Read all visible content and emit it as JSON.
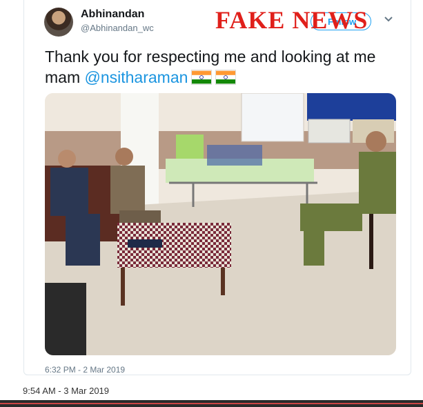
{
  "tweet": {
    "display_name": "Abhinandan",
    "handle": "@Abhinandan_wc",
    "follow_label": "Follow",
    "text_before": "Thank you for respecting me and looking at me mam ",
    "mention": "@nsitharaman",
    "flags": [
      "india-flag",
      "india-flag"
    ],
    "timestamp": "6:32 PM - 2 Mar 2019"
  },
  "overlay": {
    "fake_news_label": "FAKE NEWS",
    "color": "#e0201b"
  },
  "footer": {
    "timestamp": "9:54 AM - 3 Mar 2019"
  },
  "colors": {
    "link": "#1b95e0",
    "follow": "#1da1f2"
  },
  "icons": {
    "menu": "chevron-down-icon"
  }
}
